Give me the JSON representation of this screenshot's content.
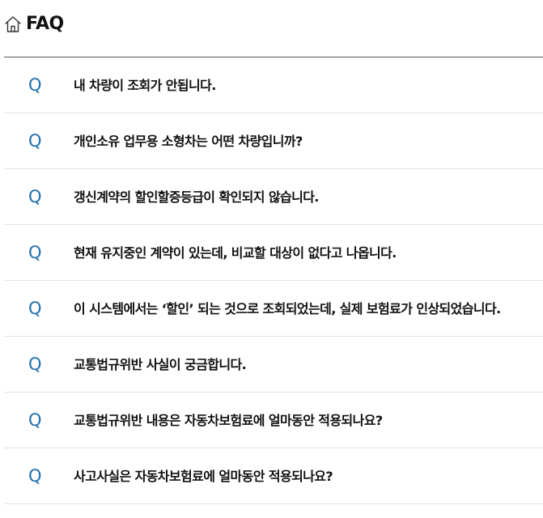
{
  "header": {
    "title": "FAQ",
    "icon": "home-icon"
  },
  "faq": {
    "q_marker": "Q",
    "accent_color": "#1f6fb0",
    "items": [
      {
        "question": "내 차량이 조회가 안됩니다."
      },
      {
        "question": "개인소유 업무용 소형차는 어떤 차량입니까?"
      },
      {
        "question": "갱신계약의 할인할증등급이 확인되지 않습니다."
      },
      {
        "question": "현재 유지중인 계약이 있는데, 비교할 대상이 없다고 나옵니다."
      },
      {
        "question": "이 시스템에서는 ‘할인’ 되는 것으로 조회되었는데, 실제 보험료가 인상되었습니다."
      },
      {
        "question": "교통법규위반 사실이 궁금합니다."
      },
      {
        "question": "교통법규위반 내용은 자동차보험료에 얼마동안 적용되나요?"
      },
      {
        "question": "사고사실은 자동차보험료에 얼마동안 적용되나요?"
      }
    ]
  }
}
